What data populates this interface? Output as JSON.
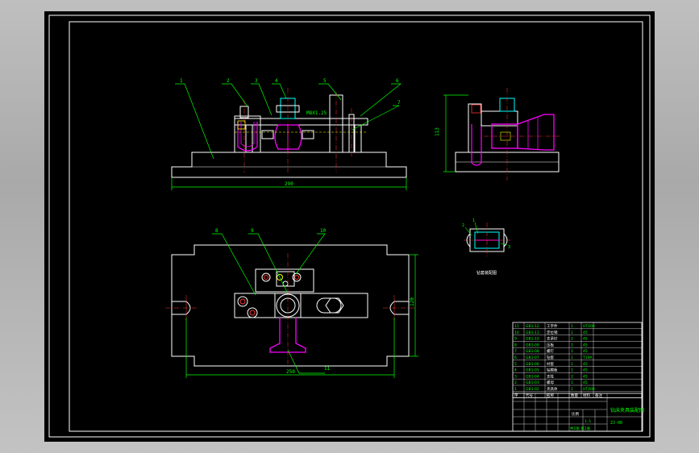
{
  "colors": {
    "frame": "#ffffff",
    "outline": "#ffffff",
    "leader": "#00ff00",
    "dimension": "#00ff00",
    "part": "#ff00ff",
    "hidden": "#ffff00",
    "bolt": "#00ffff",
    "centerline": "#ff3333",
    "sheet_bg": "#000000"
  },
  "front_view": {
    "labels": [
      "1",
      "2",
      "3",
      "4",
      "5",
      "6",
      "7"
    ],
    "annotation": "M8X1.25",
    "width_dimension": "290"
  },
  "side_view": {
    "height_dimension": "113"
  },
  "top_view": {
    "labels": [
      "8",
      "9",
      "10",
      "11"
    ],
    "width_dimension": "250",
    "height_dimension": "120"
  },
  "detail_view": {
    "caption": "钻套装配图",
    "labels": [
      "1",
      "2",
      "3"
    ]
  },
  "parts_list": {
    "rows": [
      {
        "no": "11",
        "code": "GB1-12",
        "name": "工字件",
        "qty": "1",
        "mat": "HT200"
      },
      {
        "no": "10",
        "code": "GB1-11",
        "name": "定位销",
        "qty": "1",
        "mat": "45"
      },
      {
        "no": "9",
        "code": "GB1-10",
        "name": "支承钉",
        "qty": "2",
        "mat": "45"
      },
      {
        "no": "8",
        "code": "GB1-09",
        "name": "压板",
        "qty": "1",
        "mat": "45"
      },
      {
        "no": "7",
        "code": "GB1-08",
        "name": "螺钉",
        "qty": "1",
        "mat": "45"
      },
      {
        "no": "6",
        "code": "GB1-07",
        "name": "钻套",
        "qty": "1",
        "mat": "T10A"
      },
      {
        "no": "5",
        "code": "GB1-06",
        "name": "衬套",
        "qty": "1",
        "mat": "45"
      },
      {
        "no": "4",
        "code": "GB1-05",
        "name": "钻模板",
        "qty": "1",
        "mat": "45"
      },
      {
        "no": "3",
        "code": "GB1-04",
        "name": "支柱",
        "qty": "2",
        "mat": "45"
      },
      {
        "no": "2",
        "code": "GB1-03",
        "name": "螺母",
        "qty": "1",
        "mat": "45"
      },
      {
        "no": "1",
        "code": "GB1-02",
        "name": "夹具体",
        "qty": "1",
        "mat": "HT200"
      }
    ],
    "header": [
      "序",
      "代号",
      "名称",
      "数量",
      "材料",
      "备注"
    ]
  },
  "title_block": {
    "drawing_name": "钻床夹具装配图",
    "drawing_code": "ZJ-00",
    "scale_label": "比例",
    "scale_value": "1:1",
    "sheet_label": "共1张 第1张"
  }
}
